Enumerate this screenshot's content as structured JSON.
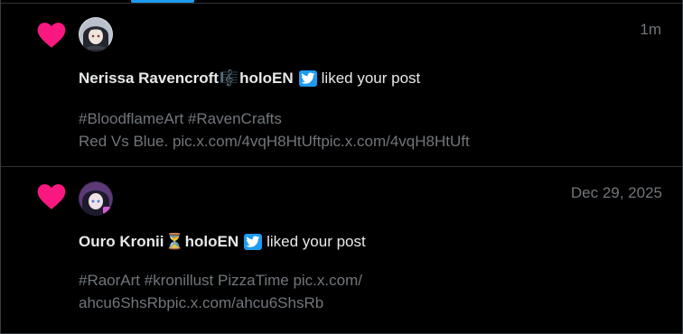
{
  "notifications": [
    {
      "type_icon": "heart-icon",
      "user_name": "Nerissa Ravencroft",
      "user_emoji": "🎼",
      "user_tag": "holoEN",
      "badge_icon": "twitter-bird-icon",
      "action": "liked your post",
      "time": "1m",
      "post_lines": [
        "#BloodflameArt #RavenCrafts",
        "Red Vs Blue. pic.x.com/4vqH8HtUftpic.x.com/4vqH8HtUft"
      ]
    },
    {
      "type_icon": "heart-icon",
      "user_name": "Ouro Kronii",
      "user_emoji": "⏳",
      "user_tag": "holoEN",
      "badge_icon": "twitter-bird-icon",
      "action": "liked your post",
      "time": "Dec 29, 2025",
      "post_lines": [
        "#RaorArt #kronillust PizzaTime pic.x.com/",
        "ahcu6ShsRbpic.x.com/ahcu6ShsRb"
      ]
    }
  ],
  "colors": {
    "background": "#000000",
    "heart": "#f91880",
    "accent": "#1d9bf0",
    "primary_text": "#e7e9ea",
    "secondary_text": "#71767b",
    "divider": "#2f3336"
  }
}
